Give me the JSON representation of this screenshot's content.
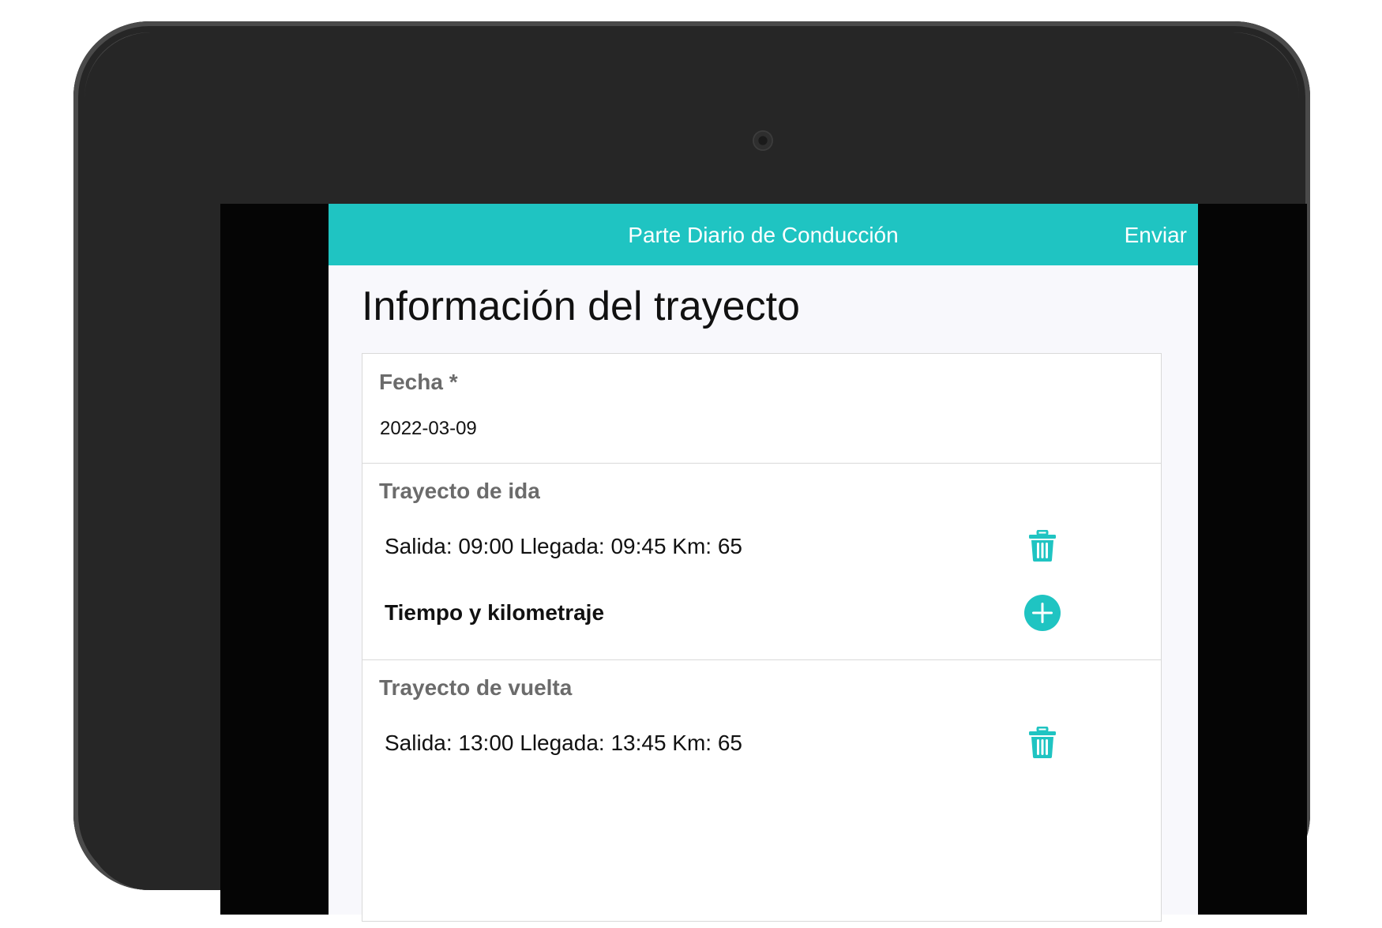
{
  "colors": {
    "accent": "#1fc4c2",
    "label_gray": "#6b6b6b",
    "text": "#111111"
  },
  "navbar": {
    "title": "Parte Diario de Conducción",
    "action_label": "Enviar"
  },
  "page": {
    "title": "Información del trayecto"
  },
  "fecha": {
    "label": "Fecha *",
    "value": "2022-03-09"
  },
  "ida": {
    "label": "Trayecto de ida",
    "entries": [
      {
        "text": "Salida: 09:00 Llegada: 09:45 Km: 65",
        "icon": "trash-icon"
      }
    ],
    "add_label": "Tiempo y kilometraje",
    "add_icon": "plus-circle-icon"
  },
  "vuelta": {
    "label": "Trayecto de vuelta",
    "entries": [
      {
        "text": "Salida: 13:00 Llegada: 13:45 Km: 65",
        "icon": "trash-icon"
      }
    ]
  }
}
